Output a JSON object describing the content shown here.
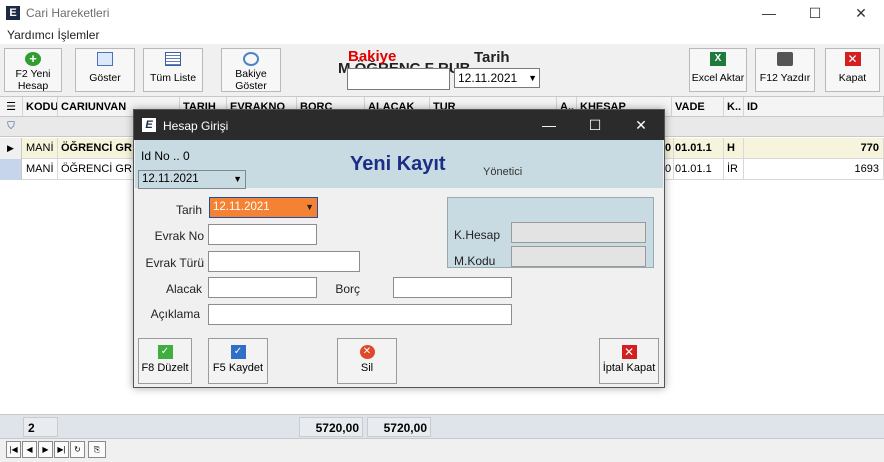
{
  "window": {
    "app_logo": "E",
    "title": "Cari Hareketleri",
    "controls": [
      "—",
      "☐",
      "✕"
    ]
  },
  "menu": {
    "item": "Yardımcı İşlemler"
  },
  "toolbar": {
    "new_line1": "F2 Yeni",
    "new_line2": "Hesap",
    "show": "Göster",
    "full_list": "Tüm Liste",
    "bakiye_show_line1": "Bakiye",
    "bakiye_show_line2": "Göster",
    "excel": "Excel Aktar",
    "print": "F12 Yazdır",
    "close": "Kapat",
    "bakiye_label": "Bakiye",
    "behind_text": "M          ÖĞRENC     F     RUB",
    "tarih_label": "Tarih",
    "tarih_value": "12.11.2021"
  },
  "grid": {
    "columns": [
      "KODU",
      "CARIUNVAN",
      "TARIH",
      "EVRAKNO",
      "BORÇ",
      "ALACAK",
      "TUR",
      "A..",
      "KHESAP",
      "VADE",
      "K..",
      "ID"
    ],
    "rows": [
      {
        "kodu": "MANİ",
        "unvan": "ÖĞRENCİ GR",
        "khesap": "0",
        "vade": "01.01.1",
        "k": "H",
        "id": "770"
      },
      {
        "kodu": "MANİ",
        "unvan": "ÖĞRENCİ GR",
        "khesap": "0",
        "vade": "01.01.1",
        "k": "İR",
        "id": "1693"
      }
    ],
    "footer": {
      "count": "2",
      "borc_total": "5720,00",
      "alacak_total": "5720,00"
    }
  },
  "dialog": {
    "logo": "E",
    "title": "Hesap Girişi",
    "controls": [
      "—",
      "☐",
      "✕"
    ],
    "id_no": "Id No .. 0",
    "header_date": "12.11.2021",
    "heading": "Yeni Kayıt",
    "user": "Yönetici",
    "labels": {
      "tarih": "Tarih",
      "evrak_no": "Evrak No",
      "evrak_turu": "Evrak Türü",
      "alacak": "Alacak",
      "borc": "Borç",
      "aciklama": "Açıklama",
      "k_hesap": "K.Hesap",
      "m_kodu": "M.Kodu"
    },
    "values": {
      "tarih": "12.11.2021",
      "evrak_no": "",
      "evrak_turu": "",
      "alacak": "",
      "borc": "",
      "aciklama": "",
      "k_hesap": "",
      "m_kodu": ""
    },
    "buttons": {
      "duzelt": "F8 Düzelt",
      "kaydet": "F5 Kaydet",
      "sil": "Sil",
      "iptal": "İptal Kapat"
    }
  },
  "colors": {
    "accent_heading": "#1b2e86",
    "bakiye_red": "#e00000",
    "dialog_panel": "#c9dbe2",
    "tarih_highlight": "#f58233"
  }
}
